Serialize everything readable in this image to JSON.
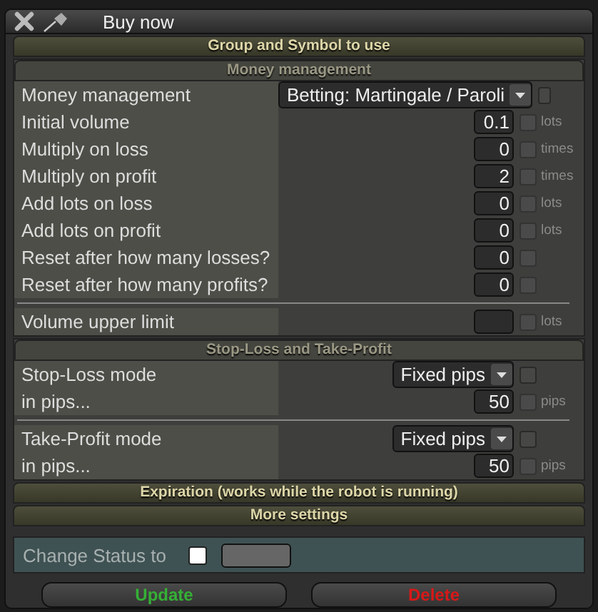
{
  "window": {
    "title": "Buy now"
  },
  "sections": [
    {
      "kind": "header",
      "title": "Group and Symbol to use"
    },
    {
      "kind": "group",
      "title": "Money management",
      "rows": [
        {
          "kind": "select",
          "label": "Money management",
          "value": "Betting: Martingale / Paroli",
          "checked": false
        },
        {
          "kind": "number",
          "label": "Initial volume",
          "value": "0.1",
          "unit": "lots",
          "checked": false
        },
        {
          "kind": "number",
          "label": "Multiply on loss",
          "value": "0",
          "unit": "times",
          "checked": false
        },
        {
          "kind": "number",
          "label": "Multiply on profit",
          "value": "2",
          "unit": "times",
          "checked": false
        },
        {
          "kind": "number",
          "label": "Add lots on loss",
          "value": "0",
          "unit": "lots",
          "checked": false
        },
        {
          "kind": "number",
          "label": "Add lots on profit",
          "value": "0",
          "unit": "lots",
          "checked": false
        },
        {
          "kind": "number",
          "label": "Reset after how many losses?",
          "value": "0",
          "checked": false
        },
        {
          "kind": "number",
          "label": "Reset after how many profits?",
          "value": "0",
          "checked": false
        },
        {
          "kind": "divider"
        },
        {
          "kind": "number",
          "label": "Volume upper limit",
          "unit": "lots",
          "checked": false
        }
      ]
    },
    {
      "kind": "group",
      "title": "Stop-Loss and Take-Profit",
      "rows": [
        {
          "kind": "select",
          "label": "Stop-Loss mode",
          "value": "Fixed pips",
          "checked": false
        },
        {
          "kind": "number",
          "label": "in pips...",
          "value": "50",
          "unit": "pips",
          "checked": false
        },
        {
          "kind": "divider"
        },
        {
          "kind": "select",
          "label": "Take-Profit mode",
          "value": "Fixed pips",
          "checked": false
        },
        {
          "kind": "number",
          "label": "in pips...",
          "value": "50",
          "unit": "pips",
          "checked": false
        }
      ]
    },
    {
      "kind": "header",
      "title": "Expiration (works while the robot is running)"
    },
    {
      "kind": "header",
      "title": "More settings"
    }
  ],
  "status": {
    "label": "Change Status to",
    "checked": false
  },
  "buttons": [
    {
      "label": "Update",
      "kind": "update"
    },
    {
      "label": "Delete",
      "kind": "delete"
    }
  ]
}
